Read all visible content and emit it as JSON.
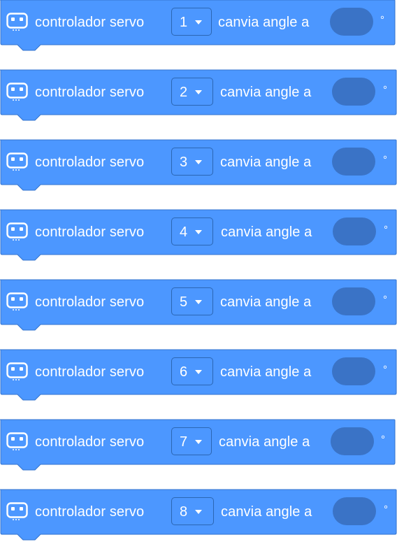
{
  "blocks": [
    {
      "prefix": "controlador servo",
      "servo": "1",
      "suffix": "canvia angle a",
      "angle": "",
      "unit": "°"
    },
    {
      "prefix": "controlador servo",
      "servo": "2",
      "suffix": "canvia angle a",
      "angle": "",
      "unit": "°"
    },
    {
      "prefix": "controlador servo",
      "servo": "3",
      "suffix": "canvia angle a",
      "angle": "",
      "unit": "°"
    },
    {
      "prefix": "controlador servo",
      "servo": "4",
      "suffix": "canvia angle a",
      "angle": "",
      "unit": "°"
    },
    {
      "prefix": "controlador servo",
      "servo": "5",
      "suffix": "canvia angle a",
      "angle": "",
      "unit": "°"
    },
    {
      "prefix": "controlador servo",
      "servo": "6",
      "suffix": "canvia angle a",
      "angle": "",
      "unit": "°"
    },
    {
      "prefix": "controlador servo",
      "servo": "7",
      "suffix": "canvia angle a",
      "angle": "",
      "unit": "°"
    },
    {
      "prefix": "controlador servo",
      "servo": "8",
      "suffix": "canvia angle a",
      "angle": "",
      "unit": "°"
    }
  ],
  "icon": "robot-icon",
  "colors": {
    "block_fill": "#4c97ff",
    "block_border": "#3373cc",
    "angle_slot": "#3a73c6",
    "text": "#ffffff"
  }
}
